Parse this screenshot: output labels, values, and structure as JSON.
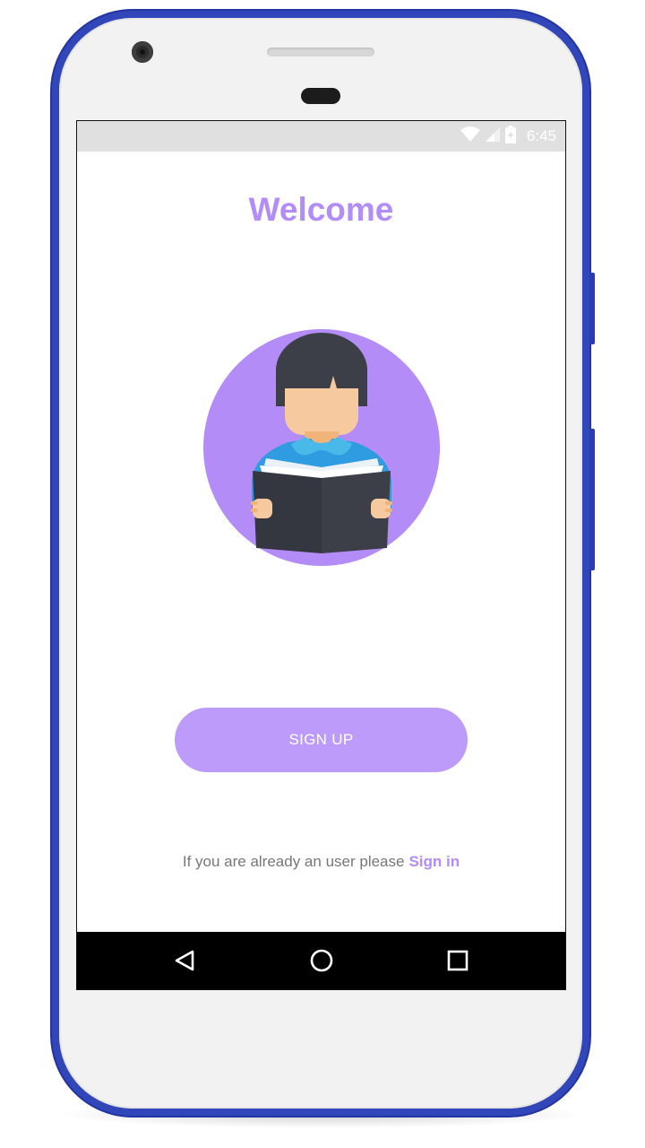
{
  "status_bar": {
    "time": "6:45",
    "icons": [
      "wifi-icon",
      "signal-icon",
      "battery-charging-icon"
    ]
  },
  "welcome": {
    "title": "Welcome"
  },
  "illustration": {
    "icon": "reading-person-icon",
    "colors": {
      "circle": "#b38cf7",
      "hair": "#3c3f48",
      "skin": "#f7c99f",
      "shirt": "#2f9be0",
      "book": "#34373f"
    }
  },
  "actions": {
    "signup_label": "SIGN UP",
    "signin_prompt": "If you are already an user please",
    "signin_label": "Sign in"
  },
  "nav_bar": {
    "icons": [
      "back-icon",
      "home-icon",
      "recents-icon"
    ]
  },
  "theme": {
    "accent": "#b28cf8",
    "button": "#bd9bfb",
    "device_frame": "#3146b8"
  }
}
